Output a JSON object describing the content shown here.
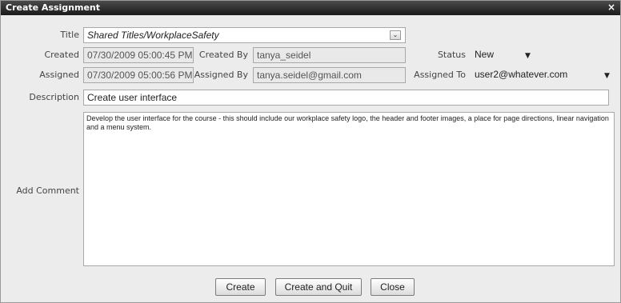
{
  "dialog": {
    "title": "Create Assignment",
    "close_glyph": "×"
  },
  "labels": {
    "title": "Title",
    "created": "Created",
    "created_by": "Created By",
    "status": "Status",
    "assigned": "Assigned",
    "assigned_by": "Assigned By",
    "assigned_to": "Assigned To",
    "description": "Description",
    "add_comment": "Add Comment"
  },
  "fields": {
    "title_value": "Shared Titles/WorkplaceSafety",
    "created_value": "07/30/2009 05:00:45 PM",
    "created_by_value": "tanya_seidel",
    "status_value": "New",
    "assigned_value": "07/30/2009 05:00:56 PM",
    "assigned_by_value": "tanya.seidel@gmail.com",
    "assigned_to_value": "user2@whatever.com",
    "description_value": "Create user interface",
    "comment_value": "Develop the user interface for the course - this should include our workplace safety logo, the header and footer images, a place for page directions, linear navigation and a menu system."
  },
  "buttons": {
    "create": "Create",
    "create_and_quit": "Create and Quit",
    "close": "Close"
  },
  "icons": {
    "dropdown": "chevron-down-icon",
    "caret": "caret-down-icon"
  }
}
